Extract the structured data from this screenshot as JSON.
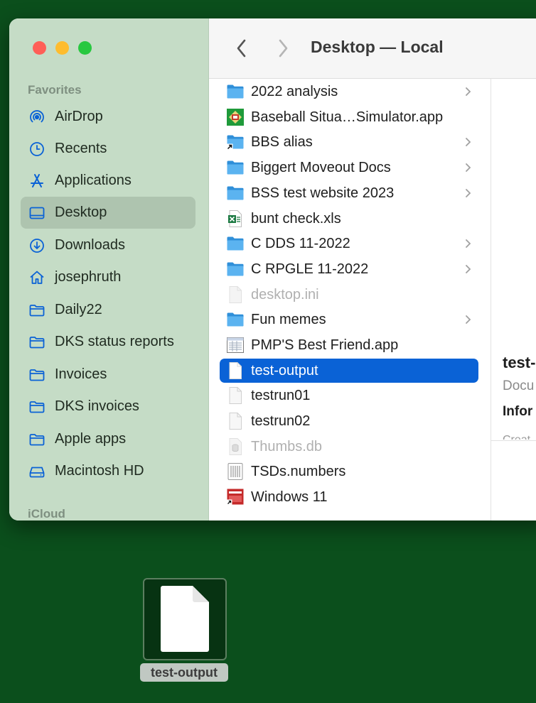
{
  "window": {
    "title": "Desktop — Local",
    "traffic_lights": [
      "close",
      "minimize",
      "zoom"
    ]
  },
  "sidebar": {
    "favorites_label": "Favorites",
    "icloud_label": "iCloud",
    "items": [
      {
        "label": "AirDrop",
        "icon": "airdrop-icon"
      },
      {
        "label": "Recents",
        "icon": "clock-icon"
      },
      {
        "label": "Applications",
        "icon": "applications-icon"
      },
      {
        "label": "Desktop",
        "icon": "desktop-icon",
        "selected": true
      },
      {
        "label": "Downloads",
        "icon": "download-icon"
      },
      {
        "label": "josephruth",
        "icon": "home-icon"
      },
      {
        "label": "Daily22",
        "icon": "folder-icon"
      },
      {
        "label": "DKS status reports",
        "icon": "folder-icon"
      },
      {
        "label": "Invoices",
        "icon": "folder-icon"
      },
      {
        "label": "DKS invoices",
        "icon": "folder-icon"
      },
      {
        "label": "Apple apps",
        "icon": "folder-icon"
      },
      {
        "label": "Macintosh HD",
        "icon": "disk-icon"
      }
    ]
  },
  "files": [
    {
      "name": "2022 analysis",
      "icon": "folder-icon",
      "chevron": true
    },
    {
      "name": "Baseball Situa…Simulator.app",
      "icon": "app-icon",
      "chevron": false
    },
    {
      "name": "BBS alias",
      "icon": "folder-alias-icon",
      "chevron": true
    },
    {
      "name": "Biggert Moveout Docs",
      "icon": "folder-icon",
      "chevron": true
    },
    {
      "name": "BSS test website 2023",
      "icon": "folder-icon",
      "chevron": true
    },
    {
      "name": "bunt check.xls",
      "icon": "excel-icon",
      "chevron": false
    },
    {
      "name": "C DDS 11-2022",
      "icon": "folder-icon",
      "chevron": true
    },
    {
      "name": "C RPGLE 11-2022",
      "icon": "folder-icon",
      "chevron": true
    },
    {
      "name": "desktop.ini",
      "icon": "document-icon",
      "chevron": false,
      "dim": true
    },
    {
      "name": "Fun memes",
      "icon": "folder-icon",
      "chevron": true
    },
    {
      "name": "PMP'S Best Friend.app",
      "icon": "app-window-icon",
      "chevron": false
    },
    {
      "name": "test-output",
      "icon": "document-icon",
      "chevron": false,
      "selected": true
    },
    {
      "name": "testrun01",
      "icon": "document-icon",
      "chevron": false
    },
    {
      "name": "testrun02",
      "icon": "document-icon",
      "chevron": false
    },
    {
      "name": "Thumbs.db",
      "icon": "database-icon",
      "chevron": false,
      "dim": true
    },
    {
      "name": "TSDs.numbers",
      "icon": "numbers-icon",
      "chevron": false
    },
    {
      "name": "Windows 11",
      "icon": "parallels-icon",
      "chevron": false
    }
  ],
  "preview": {
    "title": "test-",
    "kind": "Docu",
    "info": "Infor",
    "created": "Creat"
  },
  "desktop_icon": {
    "label": "test-output",
    "icon": "document-icon"
  },
  "colors": {
    "desktop_bg": "#0b4f1c",
    "sidebar_bg": "#c5dcc6",
    "selection": "#0a62d6",
    "folder": "#3da0e6"
  }
}
